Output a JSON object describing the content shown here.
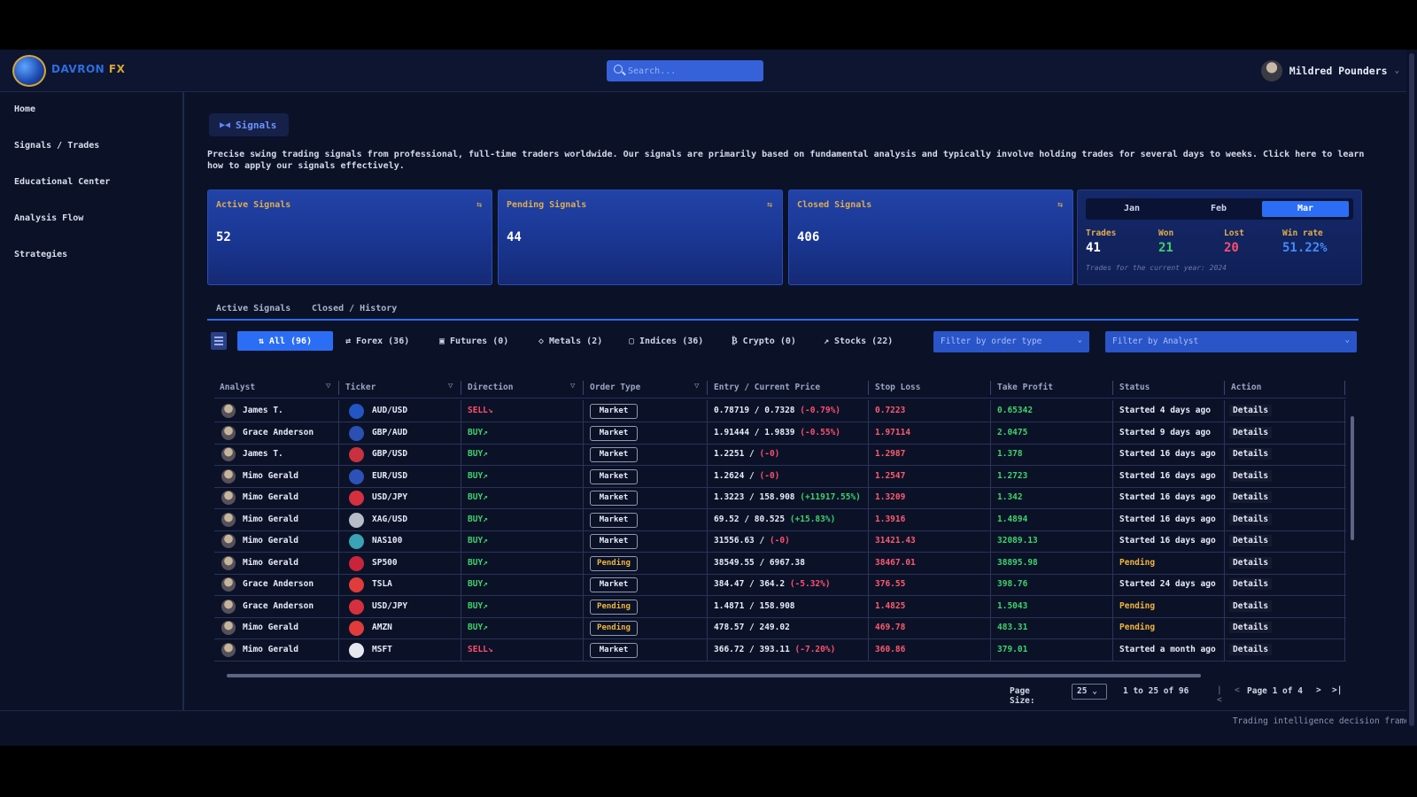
{
  "brand": {
    "name": "DAVRON",
    "suffix": "FX"
  },
  "search": {
    "placeholder": "Search..."
  },
  "user": {
    "name": "Mildred Pounders"
  },
  "sidebar": {
    "items": [
      {
        "label": "Home"
      },
      {
        "label": "Signals / Trades"
      },
      {
        "label": "Educational Center"
      },
      {
        "label": "Analysis Flow"
      },
      {
        "label": "Strategies"
      }
    ]
  },
  "page": {
    "tag": "Signals",
    "intro": "Precise swing trading signals from professional, full-time traders worldwide. Our signals are primarily based on fundamental analysis and typically involve holding trades for several days to weeks. Click here to learn how to apply our signals effectively."
  },
  "cards": [
    {
      "title": "Active Signals",
      "value": "52"
    },
    {
      "title": "Pending Signals",
      "value": "44"
    },
    {
      "title": "Closed Signals",
      "value": "406"
    }
  ],
  "stats": {
    "months": [
      "Jan",
      "Feb",
      "Mar"
    ],
    "active_month": "Mar",
    "labels": {
      "trades": "Trades",
      "won": "Won",
      "lost": "Lost",
      "winrate": "Win rate"
    },
    "values": {
      "trades": "41",
      "won": "21",
      "lost": "20",
      "winrate": "51.22%"
    },
    "note": "Trades for the current year: 2024",
    "colors": {
      "won": "#3fd16a",
      "lost": "#ff4f6d",
      "winrate": "#3f8dff"
    }
  },
  "tabs": [
    "Active Signals",
    "Closed / History"
  ],
  "filters": {
    "buttons": [
      "All (96)",
      "Forex (36)",
      "Futures (0)",
      "Metals (2)",
      "Indices (36)",
      "Crypto (0)",
      "Stocks (22)"
    ],
    "order_type_placeholder": "Filter by order type",
    "analyst_placeholder": "Filter by Analyst"
  },
  "table": {
    "headers": [
      "Analyst",
      "Ticker",
      "Direction",
      "Order Type",
      "Entry / Current Price",
      "Stop Loss",
      "Take Profit",
      "Status",
      "Action"
    ],
    "rows": [
      {
        "analyst": "James T.",
        "ticker": "AUD/USD",
        "direction": "SELL",
        "order": "Market",
        "entry": "0.78719 / 0.7328",
        "change": "(-0.79%)",
        "sl": "0.7223",
        "tp": "0.65342",
        "status": "Started 4 days ago",
        "action": "Details",
        "flag": "#2355c4",
        "chg": "neg"
      },
      {
        "analyst": "Grace Anderson",
        "ticker": "GBP/AUD",
        "direction": "BUY",
        "order": "Market",
        "entry": "1.91444 / 1.9839",
        "change": "(-0.55%)",
        "sl": "1.97114",
        "tp": "2.0475",
        "status": "Started 9 days ago",
        "action": "Details",
        "flag": "#2b4fb3",
        "chg": "neg"
      },
      {
        "analyst": "James T.",
        "ticker": "GBP/USD",
        "direction": "BUY",
        "order": "Market",
        "entry": "1.2251 /",
        "change": "(-0)",
        "sl": "1.2987",
        "tp": "1.378",
        "status": "Started 16 days ago",
        "action": "Details",
        "flag": "#c8313d",
        "chg": "neg"
      },
      {
        "analyst": "Mimo Gerald",
        "ticker": "EUR/USD",
        "direction": "BUY",
        "order": "Market",
        "entry": "1.2624 /",
        "change": "(-0)",
        "sl": "1.2547",
        "tp": "1.2723",
        "status": "Started 16 days ago",
        "action": "Details",
        "flag": "#2c52b8",
        "chg": "neg"
      },
      {
        "analyst": "Mimo Gerald",
        "ticker": "USD/JPY",
        "direction": "BUY",
        "order": "Market",
        "entry": "1.3223 / 158.908",
        "change": "(+11917.55%)",
        "sl": "1.3209",
        "tp": "1.342",
        "status": "Started 16 days ago",
        "action": "Details",
        "flag": "#d6303f",
        "chg": "pos"
      },
      {
        "analyst": "Mimo Gerald",
        "ticker": "XAG/USD",
        "direction": "BUY",
        "order": "Market",
        "entry": "69.52 / 80.525",
        "change": "(+15.83%)",
        "sl": "1.3916",
        "tp": "1.4894",
        "status": "Started 16 days ago",
        "action": "Details",
        "flag": "#b8bcc8",
        "chg": "pos"
      },
      {
        "analyst": "Mimo Gerald",
        "ticker": "NAS100",
        "direction": "BUY",
        "order": "Market",
        "entry": "31556.63 /",
        "change": "(-0)",
        "sl": "31421.43",
        "tp": "32089.13",
        "status": "Started 16 days ago",
        "action": "Details",
        "flag": "#3aa3b5",
        "chg": "neg"
      },
      {
        "analyst": "Mimo Gerald",
        "ticker": "SP500",
        "direction": "BUY",
        "order": "Pending",
        "entry": "38549.55 / 6967.38",
        "change": "",
        "sl": "38467.01",
        "tp": "38895.98",
        "status": "Pending",
        "action": "Details",
        "flag": "#c9243a",
        "chg": "none"
      },
      {
        "analyst": "Grace Anderson",
        "ticker": "TSLA",
        "direction": "BUY",
        "order": "Market",
        "entry": "384.47 / 364.2",
        "change": "(-5.32%)",
        "sl": "376.55",
        "tp": "398.76",
        "status": "Started 24 days ago",
        "action": "Details",
        "flag": "#e23b3b",
        "chg": "neg"
      },
      {
        "analyst": "Grace Anderson",
        "ticker": "USD/JPY",
        "direction": "BUY",
        "order": "Pending",
        "entry": "1.4871 / 158.908",
        "change": "",
        "sl": "1.4825",
        "tp": "1.5043",
        "status": "Pending",
        "action": "Details",
        "flag": "#d6303f",
        "chg": "none"
      },
      {
        "analyst": "Mimo Gerald",
        "ticker": "AMZN",
        "direction": "BUY",
        "order": "Pending",
        "entry": "478.57 / 249.02",
        "change": "",
        "sl": "469.78",
        "tp": "483.31",
        "status": "Pending",
        "action": "Details",
        "flag": "#e23b3b",
        "chg": "none"
      },
      {
        "analyst": "Mimo Gerald",
        "ticker": "MSFT",
        "direction": "SELL",
        "order": "Market",
        "entry": "366.72 / 393.11",
        "change": "(-7.20%)",
        "sl": "360.86",
        "tp": "379.01",
        "status": "Started a month ago",
        "action": "Details",
        "flag": "#e4e7ee",
        "chg": "neg"
      }
    ]
  },
  "pager": {
    "label": "Page Size:",
    "size": "25",
    "range": "1 to 25 of 96",
    "page": "Page 1 of 4"
  },
  "footer": {
    "text": "Trading intelligence decision frame"
  },
  "colors": {
    "sell": "#ff4f6d",
    "buy": "#3fd16a",
    "neg": "#ff4f6d",
    "pos": "#3fd16a",
    "sl": "#ff5a6e",
    "tp": "#41d36c",
    "pending": "#f0b43c"
  }
}
